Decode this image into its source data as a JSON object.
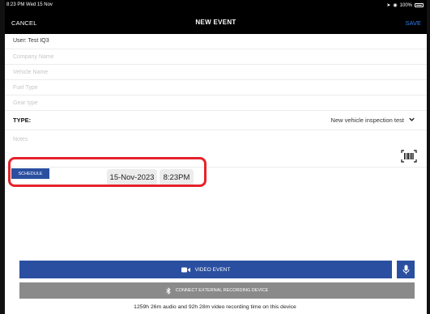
{
  "status": {
    "time": "8:23 PM  Wed 15 Nov",
    "battery": "100%"
  },
  "nav": {
    "cancel": "CANCEL",
    "title": "NEW EVENT",
    "save": "SAVE"
  },
  "form": {
    "user": "User: Test IQ3",
    "company_placeholder": "Company Name",
    "vehicle_placeholder": "Vehicle Name",
    "fuel_placeholder": "Fuel Type",
    "gear_placeholder": "Gear type",
    "type_label": "TYPE:",
    "type_value": "New vehicle inspection test",
    "notes_placeholder": "Notes"
  },
  "schedule": {
    "button": "SCHEDULE",
    "date": "15-Nov-2023",
    "time": "8:23PM"
  },
  "actions": {
    "video_event": "VIDEO EVENT",
    "connect": "CONNECT EXTERNAL RECORDING DEVICE"
  },
  "footer": "1259h 26m audio and 92h 28m video recording time on this device",
  "colors": {
    "accent": "#2a4fa0",
    "save": "#2f7ff0",
    "highlight": "#e5232b",
    "connect": "#8a8a8a"
  }
}
